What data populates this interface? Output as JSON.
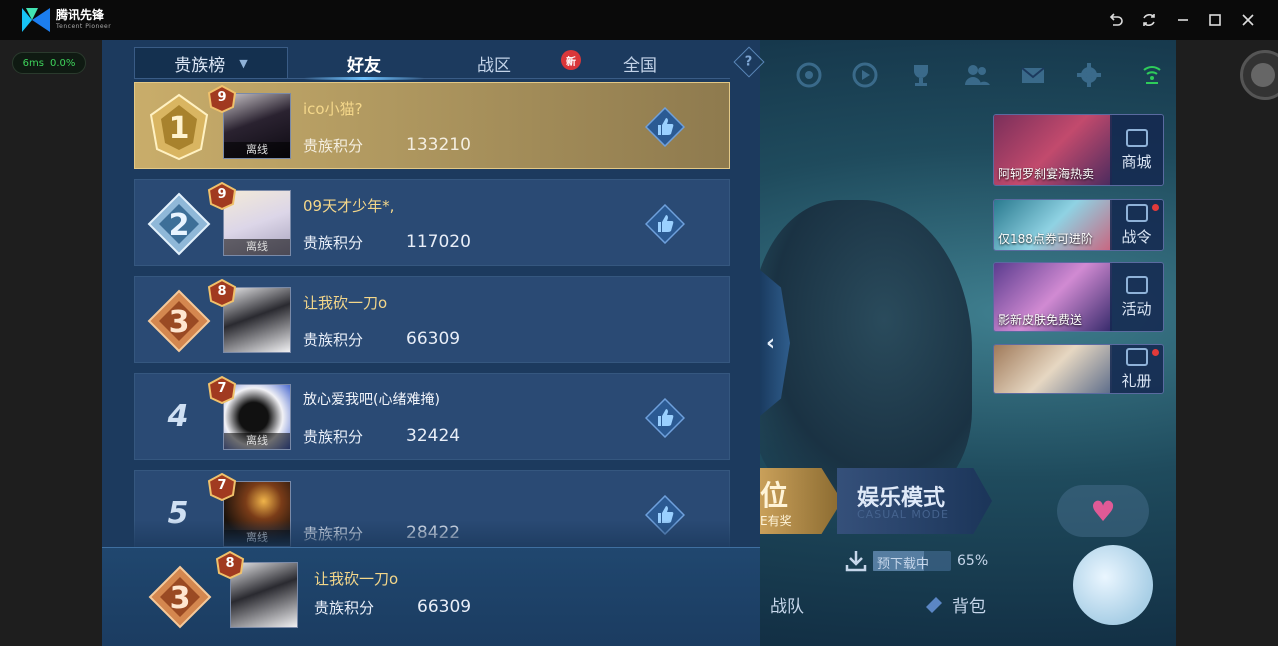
{
  "emulator": {
    "app_name": "腾讯先锋",
    "app_sub": "Tencent Pioneer",
    "ping": "6ms",
    "loss": "0.0%"
  },
  "leaderboard": {
    "dropdown_label": "贵族榜",
    "tabs": [
      "好友",
      "战区",
      "全国"
    ],
    "active_tab": "好友",
    "new_badge": "新",
    "help": "?",
    "collapse": "‹",
    "rows": [
      {
        "rank": "1",
        "level": "9",
        "name": "ico小猫?",
        "score_label": "贵族积分",
        "score": "133210",
        "status": "离线"
      },
      {
        "rank": "2",
        "level": "9",
        "name": "09天才少年*,",
        "score_label": "贵族积分",
        "score": "117020",
        "status": "离线"
      },
      {
        "rank": "3",
        "level": "8",
        "name": "让我砍一刀o",
        "score_label": "贵族积分",
        "score": "66309",
        "status": ""
      },
      {
        "rank": "4",
        "level": "7",
        "name": "放心爱我吧(心绪难掩)",
        "score_label": "贵族积分",
        "score": "32424",
        "status": "离线"
      },
      {
        "rank": "5",
        "level": "7",
        "name": "",
        "score_label": "贵族积分",
        "score": "28422",
        "status": "离线"
      }
    ],
    "self": {
      "rank": "3",
      "level": "8",
      "name": "让我砍一刀o",
      "score_label": "贵族积分",
      "score": "66309"
    }
  },
  "lobby": {
    "promos": [
      {
        "caption": "阿轲罗刹宴海热卖",
        "side": "商城"
      },
      {
        "caption": "仅188点券可进阶",
        "side": "战令"
      },
      {
        "caption": "影新皮肤免费送",
        "side": "活动"
      },
      {
        "caption": "",
        "side": "礼册"
      }
    ],
    "mode_ranked": "位",
    "mode_ranked_sub": "E有奖",
    "mode_casual": "娱乐模式",
    "mode_casual_sub": "CASUAL MODE",
    "download_label": "预下载中",
    "download_pct": "65%",
    "download_fraction": 0.65,
    "nav_team": "战队",
    "nav_bag": "背包",
    "heart": "♥"
  },
  "colors": {
    "panel": "#1c3a5e",
    "row": "#2a4a74",
    "gold_row": "#c9ad6a",
    "name_gold": "#f4d78a",
    "ping_green": "#3ed35b"
  }
}
